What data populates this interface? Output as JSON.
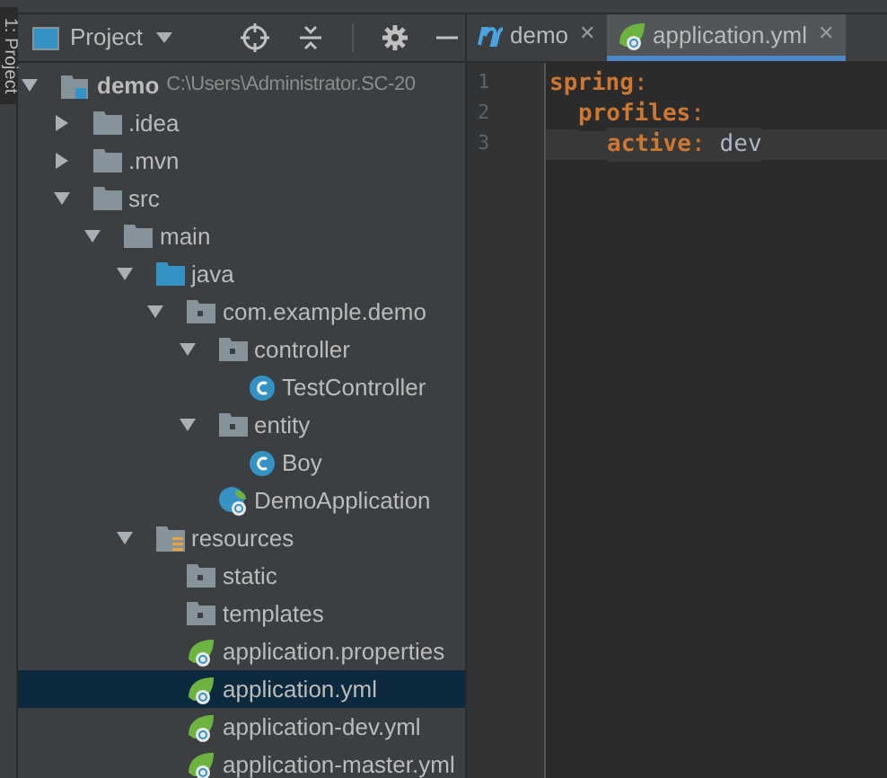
{
  "tool_stripe": {
    "label": "1: Project"
  },
  "project_panel": {
    "title": "Project",
    "tree": [
      {
        "name": "demo",
        "path": "C:\\Users\\Administrator.SC-20",
        "kind": "module",
        "expanded": true,
        "selected": false,
        "children": [
          {
            "name": ".idea",
            "kind": "folder",
            "expanded": false,
            "selected": false
          },
          {
            "name": ".mvn",
            "kind": "folder",
            "expanded": false,
            "selected": false
          },
          {
            "name": "src",
            "kind": "folder",
            "expanded": true,
            "selected": false,
            "children": [
              {
                "name": "main",
                "kind": "folder",
                "expanded": true,
                "selected": false,
                "children": [
                  {
                    "name": "java",
                    "kind": "source",
                    "expanded": true,
                    "selected": false,
                    "children": [
                      {
                        "name": "com.example.demo",
                        "kind": "package",
                        "expanded": true,
                        "selected": false,
                        "children": [
                          {
                            "name": "controller",
                            "kind": "package",
                            "expanded": true,
                            "selected": false,
                            "children": [
                              {
                                "name": "TestController",
                                "kind": "class",
                                "selected": false
                              }
                            ]
                          },
                          {
                            "name": "entity",
                            "kind": "package",
                            "expanded": true,
                            "selected": false,
                            "children": [
                              {
                                "name": "Boy",
                                "kind": "class",
                                "selected": false
                              }
                            ]
                          },
                          {
                            "name": "DemoApplication",
                            "kind": "spring-class",
                            "selected": false
                          }
                        ]
                      }
                    ]
                  },
                  {
                    "name": "resources",
                    "kind": "resources",
                    "expanded": true,
                    "selected": false,
                    "children": [
                      {
                        "name": "static",
                        "kind": "package",
                        "selected": false
                      },
                      {
                        "name": "templates",
                        "kind": "package",
                        "selected": false
                      },
                      {
                        "name": "application.properties",
                        "kind": "spring",
                        "selected": false
                      },
                      {
                        "name": "application.yml",
                        "kind": "spring",
                        "selected": true
                      },
                      {
                        "name": "application-dev.yml",
                        "kind": "spring",
                        "selected": false
                      },
                      {
                        "name": "application-master.yml",
                        "kind": "spring",
                        "selected": false
                      }
                    ]
                  }
                ]
              }
            ]
          }
        ]
      }
    ]
  },
  "editor": {
    "tabs": [
      {
        "label": "demo",
        "kind": "maven",
        "close": "✕",
        "selected": false
      },
      {
        "label": "application.yml",
        "kind": "spring",
        "close": "✕",
        "selected": true
      }
    ],
    "lines": [
      {
        "number": "1",
        "key": "spring",
        "colon": ":",
        "current": false,
        "children": [
          {
            "number": "2",
            "key": "profiles",
            "colon": ":",
            "current": false,
            "children": [
              {
                "number": "3",
                "key": "active",
                "colon": ":",
                "value": "dev",
                "current": true
              }
            ]
          }
        ]
      }
    ]
  }
}
